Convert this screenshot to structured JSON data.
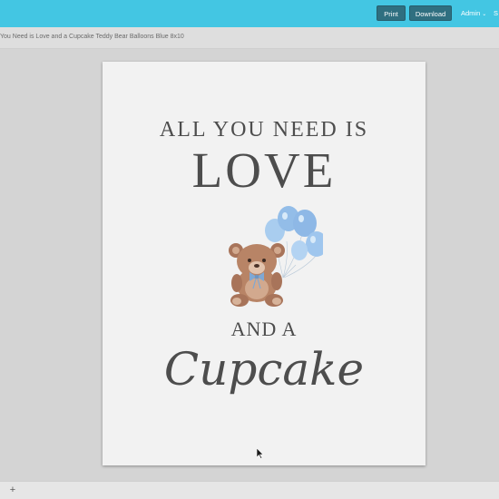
{
  "toolbar": {
    "print_label": "Print",
    "download_label": "Download",
    "user_label": "Admin",
    "edge_label": "S"
  },
  "document": {
    "title": "You Need is Love and a Cupcake Teddy Bear Balloons Blue 8x10"
  },
  "page": {
    "line1": "ALL YOU NEED IS",
    "line2": "LOVE",
    "line3": "AND A",
    "line4": "Cupcake"
  },
  "bottom": {
    "add_label": "+"
  },
  "colors": {
    "topbar": "#43c6e3",
    "button": "#2f6f80",
    "text_dark": "#4d4d4d",
    "balloon_blue": "#9cc3ea",
    "bear_brown": "#b88466"
  },
  "icons": {
    "user_menu_chevron": "chevron-down-icon",
    "illustration": "teddy-bear-balloons-icon",
    "cursor": "mouse-cursor-icon"
  }
}
